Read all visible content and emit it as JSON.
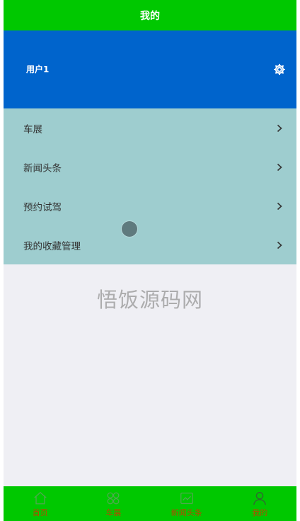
{
  "header": {
    "title": "我的"
  },
  "user": {
    "name": "用户1",
    "settings_icon": "gear-icon"
  },
  "menu": {
    "items": [
      {
        "label": "车展",
        "icon": "chevron-right-icon"
      },
      {
        "label": "新闻头条",
        "icon": "chevron-right-icon"
      },
      {
        "label": "预约试驾",
        "icon": "chevron-right-icon"
      },
      {
        "label": "我的收藏管理",
        "icon": "chevron-right-icon"
      }
    ]
  },
  "watermark": {
    "text": "悟饭源码网"
  },
  "bottom_nav": {
    "items": [
      {
        "label": "首页",
        "icon": "home-icon"
      },
      {
        "label": "车展",
        "icon": "clover-icon"
      },
      {
        "label": "新闻头条",
        "icon": "news-icon"
      },
      {
        "label": "我的",
        "icon": "user-icon"
      }
    ]
  },
  "colors": {
    "top_bar": "#00c800",
    "user_card": "#0064cc",
    "menu_bg": "#9ecdcf",
    "page_bg": "#efeff4",
    "nav_label": "#b34a00"
  }
}
